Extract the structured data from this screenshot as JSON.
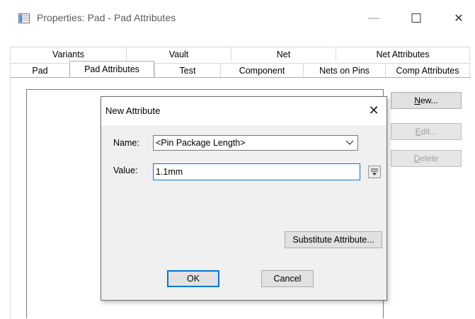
{
  "window": {
    "title": "Properties: Pad - Pad Attributes",
    "minimize_glyph": "—",
    "maximize_glyph": "☐",
    "close_glyph": "✕"
  },
  "tabs": {
    "row1": [
      "Variants",
      "Vault",
      "Net",
      "Net Attributes"
    ],
    "row2": [
      "Pad",
      "Pad Attributes",
      "Test",
      "Component",
      "Nets on Pins",
      "Comp Attributes"
    ],
    "active": "Pad Attributes"
  },
  "side_buttons": {
    "new": "New...",
    "edit": "Edit...",
    "delete": "Delete"
  },
  "dialog": {
    "title": "New Attribute",
    "close_glyph": "✕",
    "name_label": "Name:",
    "name_value": "<Pin Package Length>",
    "value_label": "Value:",
    "value_value": "1.1mm",
    "substitute_button": "Substitute Attribute...",
    "ok_button": "OK",
    "cancel_button": "Cancel"
  },
  "colors": {
    "focus_blue": "#0078d7",
    "button_face": "#e1e1e1",
    "dialog_face": "#f0f0f0"
  }
}
